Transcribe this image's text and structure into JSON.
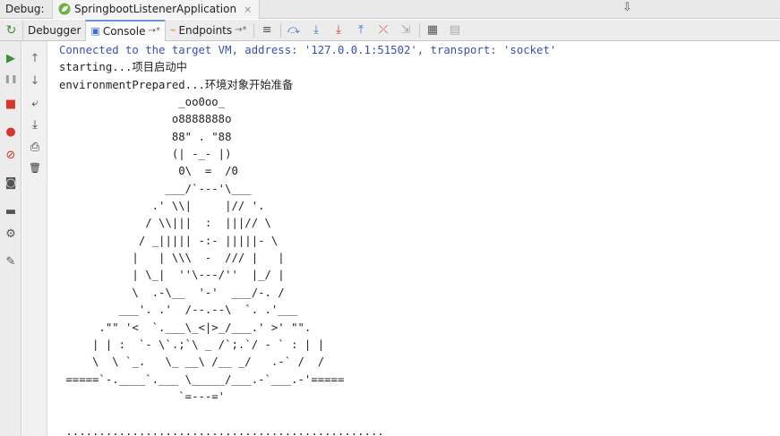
{
  "titlebar": {
    "title": "Debug:",
    "run_tab": {
      "label": "SpringbootListenerApplication",
      "close": "×",
      "icon": "spring-leaf-icon"
    }
  },
  "toolbar": {
    "subtabs": [
      {
        "label": "Debugger",
        "pin": ""
      },
      {
        "label": "Console",
        "pin": "→*"
      },
      {
        "label": "Endpoints",
        "pin": "→*"
      }
    ],
    "buttons": [
      {
        "name": "show-execution-point-icon",
        "glyph": "≡"
      },
      {
        "name": "step-over-icon",
        "glyph": "⤼"
      },
      {
        "name": "step-into-icon",
        "glyph": "⤓"
      },
      {
        "name": "force-step-into-icon",
        "glyph": "⤓"
      },
      {
        "name": "step-out-icon",
        "glyph": "⤒"
      },
      {
        "name": "drop-frame-icon",
        "glyph": "⤫"
      },
      {
        "name": "run-to-cursor-icon",
        "glyph": "⇲"
      },
      {
        "name": "evaluate-expression-icon",
        "glyph": "▦"
      },
      {
        "name": "trace-icon",
        "glyph": "▤"
      }
    ]
  },
  "console": {
    "vm_line": "Connected to the target VM, address: '127.0.0.1:51502', transport: 'socket'",
    "lines": [
      "starting...项目启动中",
      "environmentPrepared...环境对象开始准备",
      "                  _oo0oo_",
      "                 o8888888o",
      "                 88\" . \"88",
      "                 (| -_- |)",
      "                  0\\  =  /0",
      "                ___/`---'\\___",
      "              .' \\\\|     |// '.",
      "             / \\\\|||  :  |||// \\",
      "            / _||||| -:- |||||- \\",
      "           |   | \\\\\\  -  /// |   |",
      "           | \\_|  ''\\---/''  |_/ |",
      "           \\  .-\\__  '-'  ___/-. /",
      "         ___'. .'  /--.--\\  `. .'___",
      "      .\"\" '<  `.___\\_<|>_/___.' >' \"\".",
      "     | | :  `- \\`.;`\\ _ /`;.`/ - ` : | |",
      "     \\  \\ `_.   \\_ __\\ /__ _/   .-` /  /",
      " =====`-.____`.___ \\_____/___.-`___.-'=====",
      "                  `=---='",
      "",
      " ................................................"
    ]
  },
  "gutter": [
    {
      "name": "scroll-up-icon",
      "glyph": "↑"
    },
    {
      "name": "scroll-down-icon",
      "glyph": "↓"
    },
    {
      "name": "soft-wrap-icon",
      "glyph": "⤶"
    },
    {
      "name": "scroll-to-end-icon",
      "glyph": "⤓"
    },
    {
      "name": "print-icon",
      "glyph": "⎙"
    },
    {
      "name": "clear-all-icon",
      "glyph": "🗑"
    }
  ],
  "sidebar": [
    {
      "name": "resume-program-icon",
      "glyph": "▶",
      "color": "#3c8f3c"
    },
    {
      "name": "pause-program-icon",
      "glyph": "❚❚",
      "color": "#9a9a9a"
    },
    {
      "name": "stop-icon",
      "glyph": "■",
      "color": "#d9352a"
    },
    {
      "name": "view-breakpoints-icon",
      "glyph": "●",
      "color": "#d9352a"
    },
    {
      "name": "mute-breakpoints-icon",
      "glyph": "⊘",
      "color": "#d9352a"
    },
    {
      "name": "camera-icon",
      "glyph": "◙",
      "color": "#555555"
    },
    {
      "name": "layout-icon",
      "glyph": "▬",
      "color": "#555555"
    },
    {
      "name": "settings-icon",
      "glyph": "⚙",
      "color": "#555555"
    },
    {
      "name": "pin-icon",
      "glyph": "✎",
      "color": "#555555"
    }
  ]
}
